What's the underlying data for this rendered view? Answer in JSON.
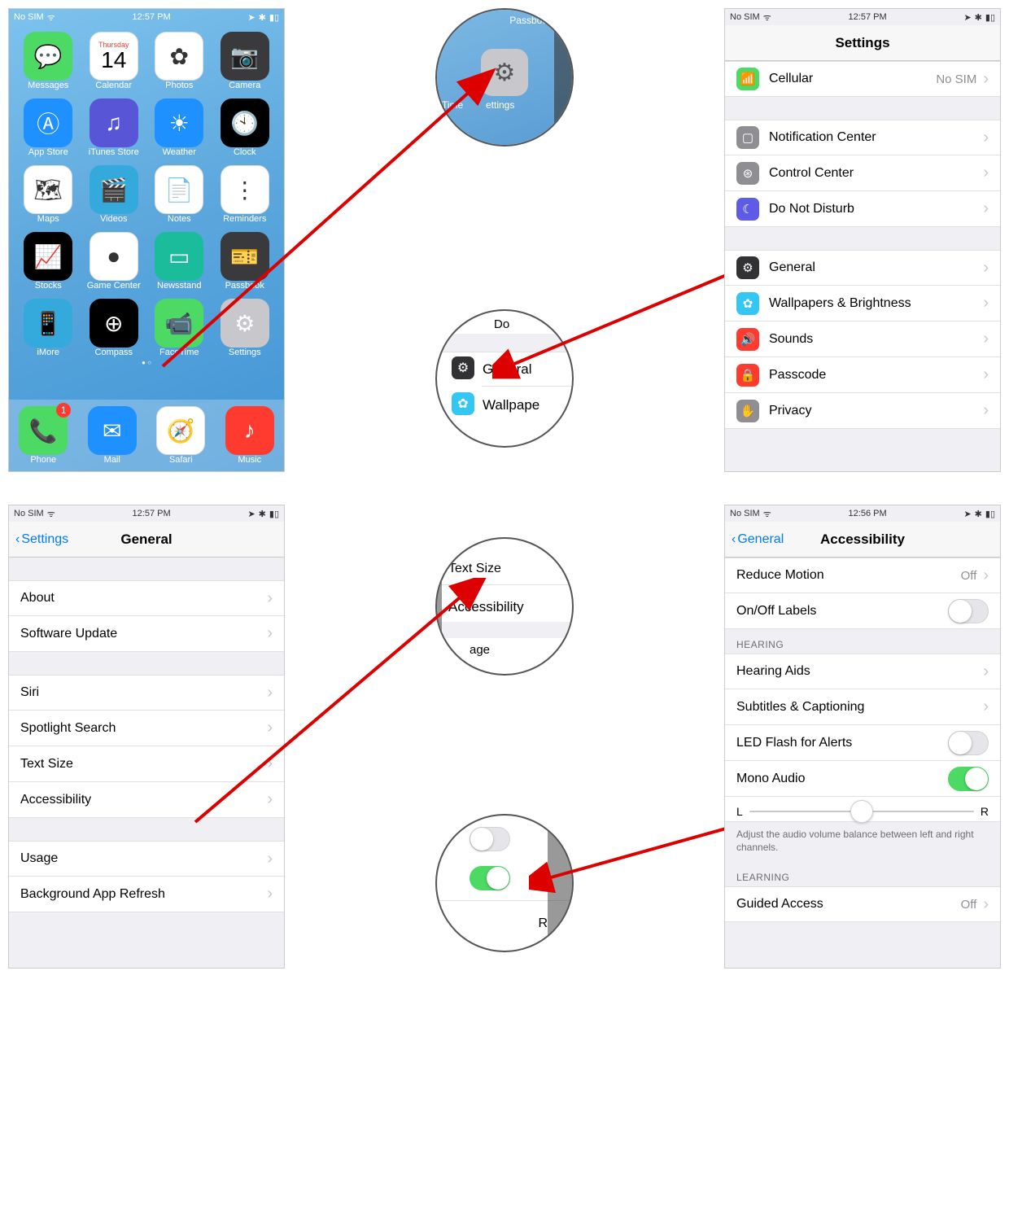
{
  "status": {
    "carrier": "No SIM",
    "wifi": "ᯤ",
    "time1": "12:57 PM",
    "time2": "12:56 PM",
    "nav": "➤",
    "bt": "✱",
    "batt": "▮▯"
  },
  "home": {
    "apps": [
      {
        "label": "Messages",
        "emoji": "💬",
        "bg": "bg-green"
      },
      {
        "label": "Calendar",
        "weekday": "Thursday",
        "day": "14",
        "bg": "bg-white"
      },
      {
        "label": "Photos",
        "emoji": "✿",
        "bg": "bg-white"
      },
      {
        "label": "Camera",
        "emoji": "📷",
        "bg": "bg-dark"
      },
      {
        "label": "App Store",
        "emoji": "Ⓐ",
        "bg": "bg-blue"
      },
      {
        "label": "iTunes Store",
        "emoji": "♫",
        "bg": "bg-purple"
      },
      {
        "label": "Weather",
        "emoji": "☀",
        "bg": "bg-blue"
      },
      {
        "label": "Clock",
        "emoji": "🕙",
        "bg": "bg-black"
      },
      {
        "label": "Maps",
        "emoji": "🗺",
        "bg": "bg-white"
      },
      {
        "label": "Videos",
        "emoji": "🎬",
        "bg": "bg-cyan"
      },
      {
        "label": "Notes",
        "emoji": "📄",
        "bg": "bg-white"
      },
      {
        "label": "Reminders",
        "emoji": "⋮",
        "bg": "bg-white"
      },
      {
        "label": "Stocks",
        "emoji": "📈",
        "bg": "bg-black"
      },
      {
        "label": "Game Center",
        "emoji": "●",
        "bg": "bg-white"
      },
      {
        "label": "Newsstand",
        "emoji": "▭",
        "bg": "bg-teal"
      },
      {
        "label": "Passbook",
        "emoji": "🎫",
        "bg": "bg-dark"
      },
      {
        "label": "iMore",
        "emoji": "📱",
        "bg": "bg-cyan"
      },
      {
        "label": "Compass",
        "emoji": "⊕",
        "bg": "bg-black"
      },
      {
        "label": "FaceTime",
        "emoji": "📹",
        "bg": "bg-green"
      },
      {
        "label": "Settings",
        "emoji": "⚙",
        "bg": "bg-lgray"
      }
    ],
    "dock": [
      {
        "label": "Phone",
        "emoji": "📞",
        "bg": "bg-green",
        "badge": "1"
      },
      {
        "label": "Mail",
        "emoji": "✉",
        "bg": "bg-blue"
      },
      {
        "label": "Safari",
        "emoji": "🧭",
        "bg": "bg-white"
      },
      {
        "label": "Music",
        "emoji": "♪",
        "bg": "bg-red"
      }
    ]
  },
  "settings": {
    "title": "Settings",
    "rows1": [
      {
        "icon": "📶",
        "bg": "si-green",
        "label": "Cellular",
        "value": "No SIM"
      }
    ],
    "rows2": [
      {
        "icon": "▢",
        "bg": "si-gray",
        "label": "Notification Center"
      },
      {
        "icon": "⊛",
        "bg": "si-gray",
        "label": "Control Center"
      },
      {
        "icon": "☾",
        "bg": "si-moon",
        "label": "Do Not Disturb"
      }
    ],
    "rows3": [
      {
        "icon": "⚙",
        "bg": "si-dark",
        "label": "General"
      },
      {
        "icon": "✿",
        "bg": "si-cyan",
        "label": "Wallpapers & Brightness"
      },
      {
        "icon": "🔊",
        "bg": "si-red",
        "label": "Sounds"
      },
      {
        "icon": "🔒",
        "bg": "si-red",
        "label": "Passcode"
      },
      {
        "icon": "✋",
        "bg": "si-hand",
        "label": "Privacy"
      }
    ]
  },
  "general": {
    "back": "Settings",
    "title": "General",
    "g1": [
      {
        "label": "About"
      },
      {
        "label": "Software Update"
      }
    ],
    "g2": [
      {
        "label": "Siri"
      },
      {
        "label": "Spotlight Search"
      },
      {
        "label": "Text Size"
      },
      {
        "label": "Accessibility"
      }
    ],
    "g3": [
      {
        "label": "Usage"
      },
      {
        "label": "Background App Refresh"
      }
    ]
  },
  "accessibility": {
    "back": "General",
    "title": "Accessibility",
    "top": [
      {
        "label": "Reduce Motion",
        "value": "Off",
        "type": "chevron"
      },
      {
        "label": "On/Off Labels",
        "type": "toggle",
        "on": false
      }
    ],
    "hearing_header": "HEARING",
    "hearing": [
      {
        "label": "Hearing Aids",
        "type": "chevron"
      },
      {
        "label": "Subtitles & Captioning",
        "type": "chevron"
      },
      {
        "label": "LED Flash for Alerts",
        "type": "toggle",
        "on": false
      },
      {
        "label": "Mono Audio",
        "type": "toggle",
        "on": true
      }
    ],
    "slider": {
      "left": "L",
      "right": "R"
    },
    "footer": "Adjust the audio volume balance between left and right channels.",
    "learning_header": "LEARNING",
    "learning": [
      {
        "label": "Guided Access",
        "value": "Off",
        "type": "chevron"
      }
    ]
  },
  "zoom": {
    "z1": {
      "top": "Passbook",
      "left": "Time",
      "center": "ettings"
    },
    "z2": {
      "do": "Do",
      "general": "General",
      "wall": "Wallpape"
    },
    "z3": {
      "ts": "Text Size",
      "acc": "Accessibility",
      "age": "age"
    },
    "z4": {
      "r": "R"
    }
  }
}
